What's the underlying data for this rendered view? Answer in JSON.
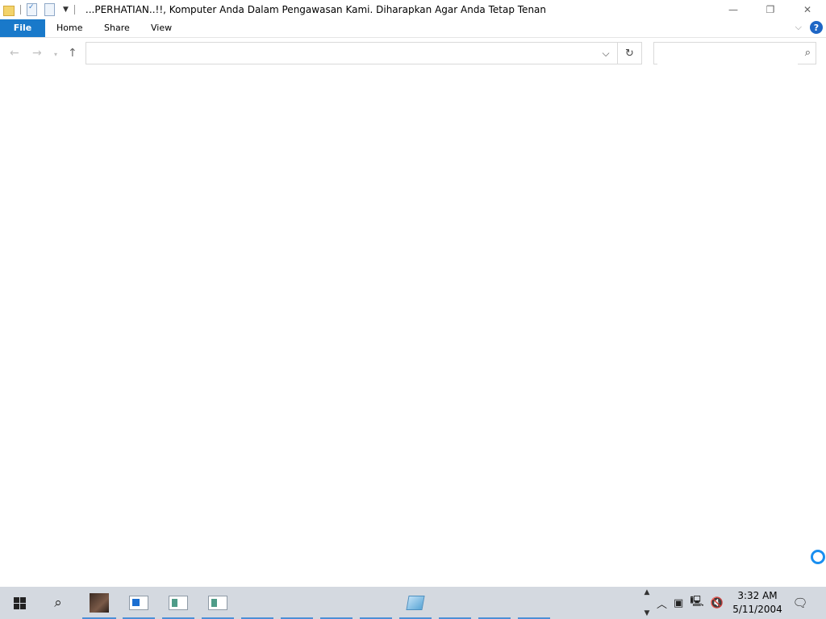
{
  "window": {
    "title": "...PERHATIAN..!!, Komputer Anda Dalam Pengawasan Kami. Diharapkan Agar Anda Tetap Tenan",
    "controls": {
      "minimize": "—",
      "restore": "❐",
      "close": "✕"
    }
  },
  "ribbon": {
    "tabs": [
      {
        "label": "File",
        "active": true
      },
      {
        "label": "Home"
      },
      {
        "label": "Share"
      },
      {
        "label": "View"
      }
    ],
    "help_label": "?"
  },
  "nav": {
    "back_icon": "arrow-left-icon",
    "forward_icon": "arrow-right-icon",
    "up_icon": "arrow-up-icon",
    "address_value": "",
    "search_placeholder": ""
  },
  "taskbar": {
    "clock_time": "3:32 AM",
    "clock_date": "5/11/2004"
  },
  "colors": {
    "file_tab": "#1979ca",
    "taskbar_bg": "#d4d9e0",
    "accent": "#4c8fd6",
    "help": "#1e66c5"
  }
}
